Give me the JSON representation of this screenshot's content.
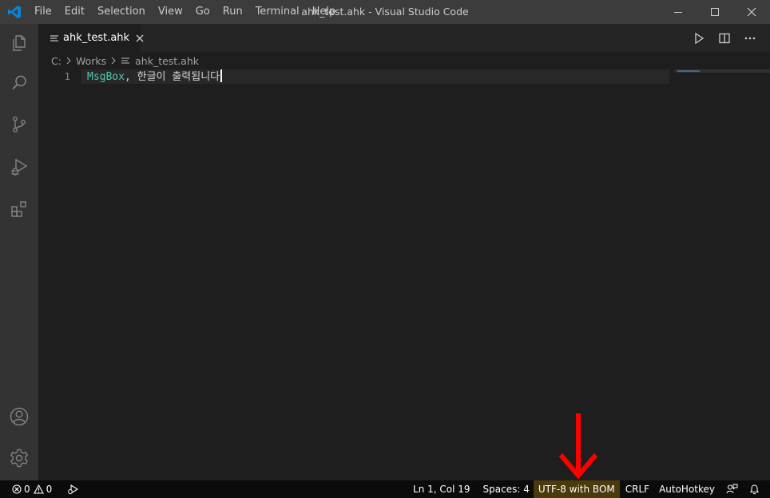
{
  "window": {
    "title": "ahk_test.ahk - Visual Studio Code"
  },
  "menu": [
    "File",
    "Edit",
    "Selection",
    "View",
    "Go",
    "Run",
    "Terminal",
    "Help"
  ],
  "activity_bar": {
    "items": [
      "explorer-icon",
      "search-icon",
      "source-control-icon",
      "run-debug-icon",
      "extensions-icon"
    ],
    "bottom": [
      "accounts-icon",
      "manage-gear-icon"
    ]
  },
  "tab": {
    "label": "ahk_test.ahk"
  },
  "breadcrumb": {
    "drive": "C:",
    "folder": "Works",
    "file": "ahk_test.ahk"
  },
  "editor": {
    "line_number": "1",
    "code_keyword": "MsgBox",
    "code_rest": ", 한글이 출력됩니다"
  },
  "status_bar": {
    "errors": "0",
    "warnings": "0",
    "position": "Ln 1, Col 19",
    "spaces": "Spaces: 4",
    "encoding": "UTF-8 with BOM",
    "eol": "CRLF",
    "language": "AutoHotkey"
  },
  "colors": {
    "title_bar": "#3c3c3c",
    "activity_bar": "#333333",
    "editor_bg": "#1e1e1e",
    "status_bar": "#0b0b0b",
    "encoding_highlight": "#4a3a0c",
    "annotation_arrow": "#ff0000",
    "vscode_blue": "#0a84d6"
  }
}
